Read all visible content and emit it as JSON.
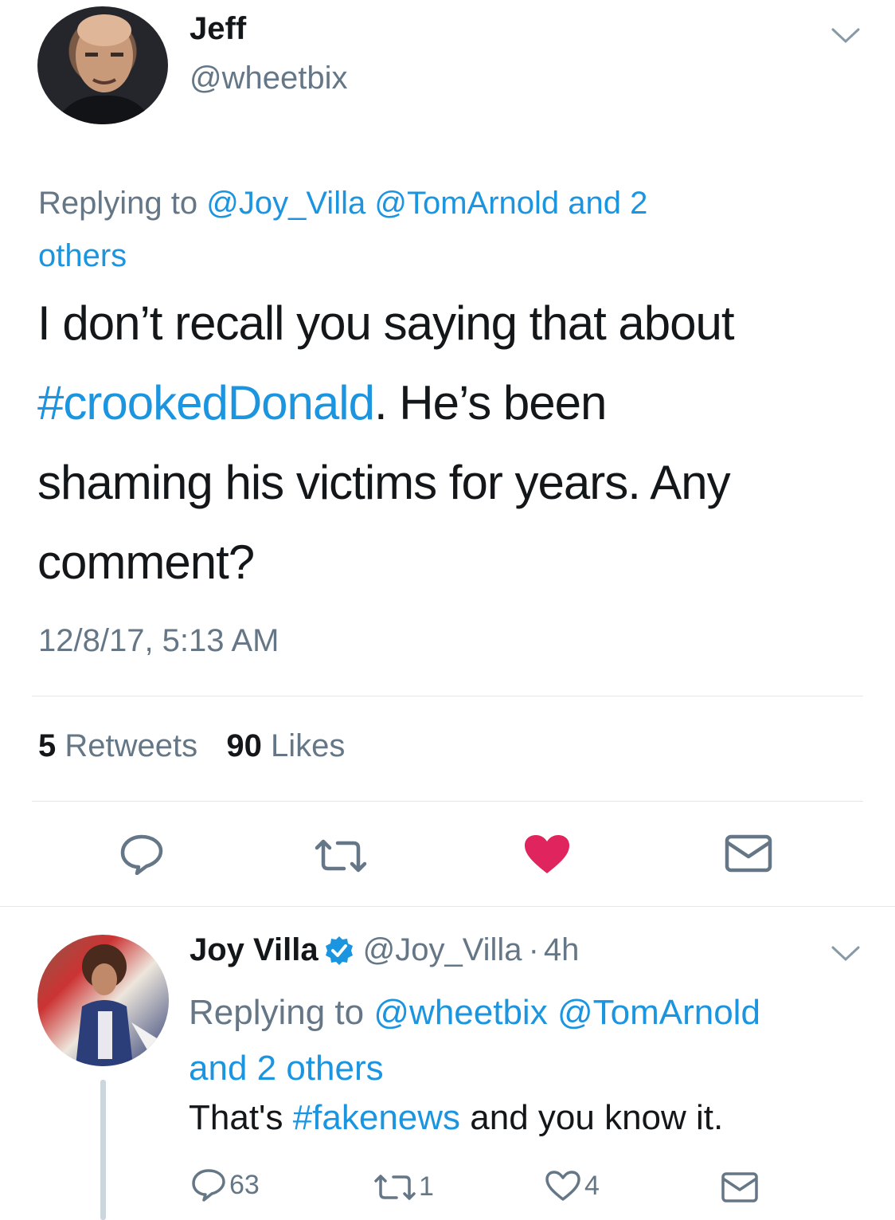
{
  "main_tweet": {
    "display_name": "Jeff",
    "handle": "@wheetbix",
    "reply_prefix": "Replying to",
    "reply_mentions": [
      "@Joy_Villa",
      "@TomArnold"
    ],
    "reply_others_line1": "and 2",
    "reply_others_line2": "others",
    "text_line1": "I don’t recall you saying that about",
    "hashtag": "#crookedDonald",
    "text_line2_rest": ". He’s been",
    "text_line3": "shaming his victims for years. Any",
    "text_line4": "comment?",
    "timestamp": "12/8/17, 5:13 AM",
    "retweets_count": "5",
    "retweets_label": "Retweets",
    "likes_count": "90",
    "likes_label": "Likes",
    "actions": {
      "reply_icon": "reply-icon",
      "retweet_icon": "retweet-icon",
      "like_icon": "heart-filled-icon",
      "dm_icon": "envelope-icon"
    },
    "like_color": "#e0245e"
  },
  "reply_tweet": {
    "display_name": "Joy Villa",
    "verified_icon": "verified-badge-icon",
    "handle": "@Joy_Villa",
    "separator": "·",
    "time": "4h",
    "reply_prefix": "Replying to",
    "reply_mentions": [
      "@wheetbix",
      "@TomArnold"
    ],
    "reply_others": "and 2 others",
    "text_before": "That's",
    "hashtag": "#fakenews",
    "text_after": "and you know it.",
    "replies_count": "63",
    "retweets_count": "1",
    "likes_count": "4"
  },
  "colors": {
    "link_blue": "#1b95e0",
    "secondary_grey": "#657786",
    "divider": "#e1e8ed",
    "like_red": "#e0245e"
  }
}
